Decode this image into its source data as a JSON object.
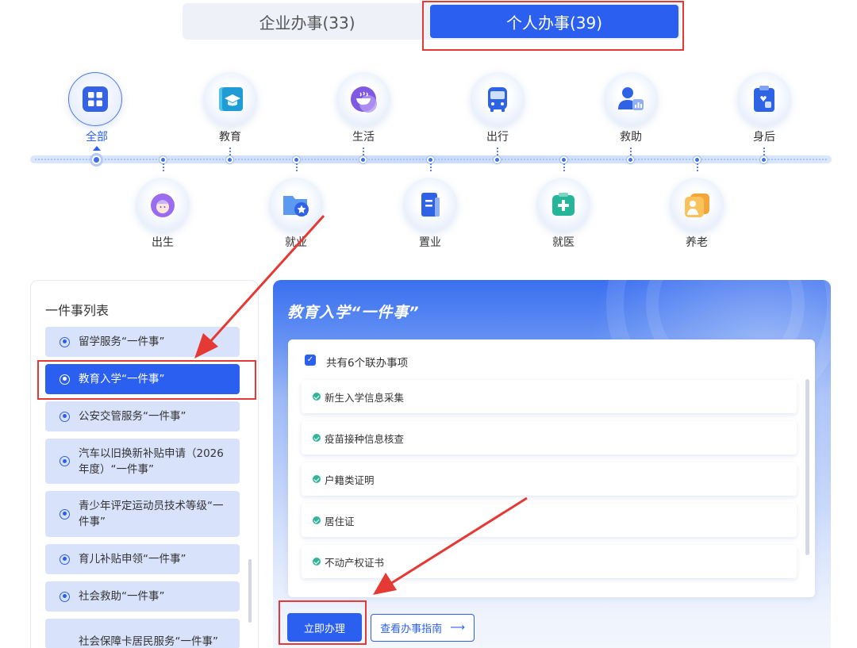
{
  "tabs": [
    {
      "label": "企业办事(33)"
    },
    {
      "label": "个人办事(39)",
      "active": true
    }
  ],
  "categories_top": [
    {
      "label": "全部",
      "icon": "grid-icon",
      "active": true
    },
    {
      "label": "教育",
      "icon": "graduation-cap-icon"
    },
    {
      "label": "生活",
      "icon": "cup-icon"
    },
    {
      "label": "出行",
      "icon": "bus-icon"
    },
    {
      "label": "救助",
      "icon": "person-chart-icon"
    },
    {
      "label": "身后",
      "icon": "clipboard-icon"
    }
  ],
  "categories_bottom": [
    {
      "label": "出生",
      "icon": "baby-icon"
    },
    {
      "label": "就业",
      "icon": "folder-star-icon"
    },
    {
      "label": "置业",
      "icon": "building-icon"
    },
    {
      "label": "就医",
      "icon": "medical-cross-icon"
    },
    {
      "label": "养老",
      "icon": "elderly-icon"
    }
  ],
  "list": {
    "title": "一件事列表",
    "items": [
      "留学服务“一件事”",
      "教育入学“一件事”",
      "公安交管服务“一件事”",
      "汽车以旧换新补贴申请（2026年度）“一件事”",
      "青少年评定运动员技术等级“一件事”",
      "育儿补贴申领“一件事”",
      "社会救助“一件事”",
      "社会保障卡居民服务“一件事”"
    ],
    "active_index": 1
  },
  "detail": {
    "title": "教育入学“一件事”",
    "summary": "共有6个联办事项",
    "tasks": [
      "新生入学信息采集",
      "疫苗接种信息核查",
      "户籍类证明",
      "居住证",
      "不动产权证书"
    ],
    "apply_label": "立即办理",
    "guide_label": "查看办事指南",
    "guide_arrow": "⟶"
  },
  "colors": {
    "primary": "#2b5ff0",
    "annotation": "#e53935",
    "check": "#34b59a"
  }
}
